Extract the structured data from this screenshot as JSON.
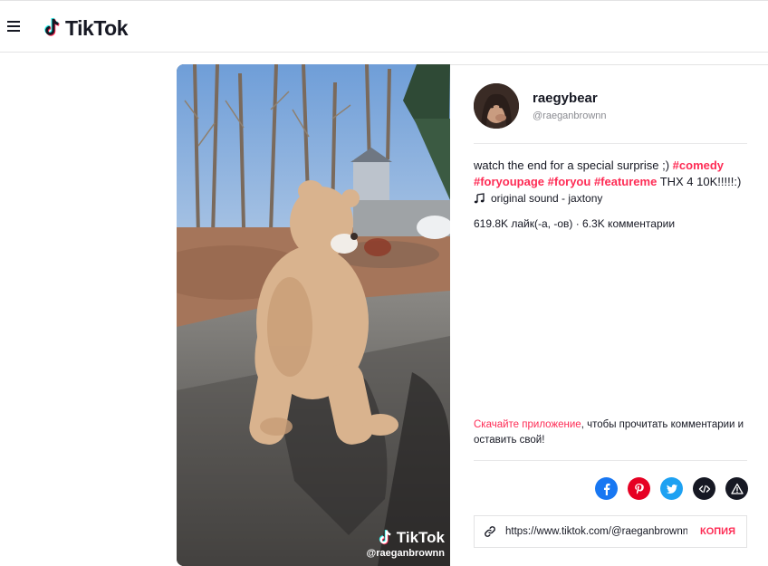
{
  "header": {
    "logo_text": "TikTok"
  },
  "video": {
    "watermark_logo": "TikTok",
    "watermark_user": "@raeganbrownn"
  },
  "author": {
    "nickname": "raegybear",
    "username": "@raeganbrownn"
  },
  "description": {
    "text_1": "watch the end for a special surprise ;) ",
    "tags": [
      "#comedy",
      "#foryoupage",
      "#foryou",
      "#featureme"
    ],
    "text_2": " THX 4 10K!!!!!:)"
  },
  "music": {
    "label": "original sound - jaxtony"
  },
  "stats": {
    "text": "619.8K лайк(-а, -ов) · 6.3K комментарии"
  },
  "cta": {
    "link_text": "Скачайте приложение",
    "rest_text": ", чтобы прочитать комментарии и оставить свой!"
  },
  "share": {
    "buttons": [
      "facebook-icon",
      "pinterest-icon",
      "twitter-icon",
      "embed-icon",
      "report-icon"
    ],
    "colors": {
      "facebook": "#1877f2",
      "pinterest": "#e60023",
      "twitter": "#1da1f2",
      "embed": "#161823",
      "report": "#161823"
    }
  },
  "copy_link": {
    "url": "https://www.tiktok.com/@raeganbrownn/video/",
    "button_label": "КОПИЯ"
  },
  "colors": {
    "accent": "#fe2c55",
    "text": "#161823",
    "muted": "#8a8b91"
  }
}
